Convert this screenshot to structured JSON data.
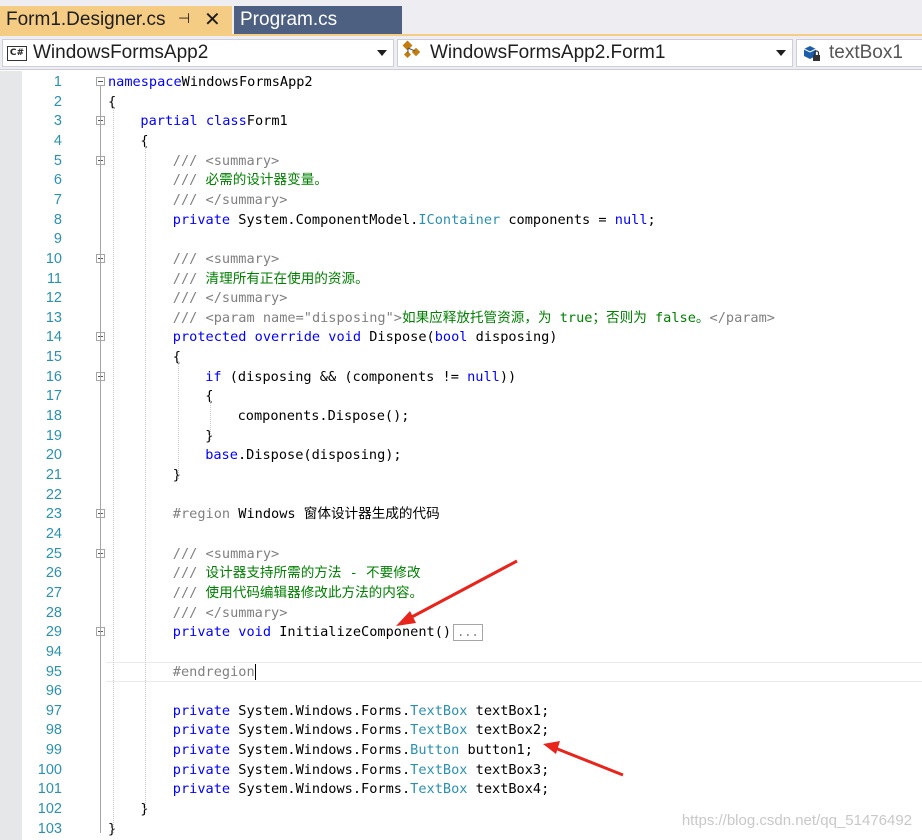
{
  "tabs": [
    {
      "label": "Form1.Designer.cs",
      "active": true
    },
    {
      "label": "Program.cs",
      "active": false
    }
  ],
  "navbar": {
    "project": "WindowsFormsApp2",
    "type": "WindowsFormsApp2.Form1",
    "member": "textBox1"
  },
  "lines": [
    {
      "n": "1",
      "fold": "minus",
      "tokens": [
        [
          "kw",
          "namespace"
        ],
        [
          "",
          "WindowsFormsApp2"
        ]
      ]
    },
    {
      "n": "2",
      "tokens": [
        [
          "",
          "{"
        ]
      ]
    },
    {
      "n": "3",
      "fold": "minus",
      "indent": 1,
      "tokens": [
        [
          "kw",
          "partial class"
        ],
        [
          "",
          "Form1"
        ]
      ]
    },
    {
      "n": "4",
      "indent": 1,
      "tokens": [
        [
          "",
          "{"
        ]
      ]
    },
    {
      "n": "5",
      "fold": "minus",
      "indent": 2,
      "tokens": [
        [
          "cmg",
          "///"
        ],
        [
          "cmg",
          " <summary>"
        ]
      ]
    },
    {
      "n": "6",
      "indent": 2,
      "tokens": [
        [
          "cmg",
          "///"
        ],
        [
          "cm",
          " 必需的设计器变量。"
        ]
      ]
    },
    {
      "n": "7",
      "indent": 2,
      "tokens": [
        [
          "cmg",
          "///"
        ],
        [
          "cmg",
          " </summary>"
        ]
      ]
    },
    {
      "n": "8",
      "indent": 2,
      "tokens": [
        [
          "kw",
          "private"
        ],
        [
          "",
          " System.ComponentModel."
        ],
        [
          "ty",
          "IContainer"
        ],
        [
          "",
          " components = "
        ],
        [
          "kw",
          "null"
        ],
        [
          "",
          ";"
        ]
      ]
    },
    {
      "n": "9",
      "tokens": []
    },
    {
      "n": "10",
      "fold": "minus",
      "indent": 2,
      "tokens": [
        [
          "cmg",
          "///"
        ],
        [
          "cmg",
          " <summary>"
        ]
      ]
    },
    {
      "n": "11",
      "indent": 2,
      "tokens": [
        [
          "cmg",
          "///"
        ],
        [
          "cm",
          " 清理所有正在使用的资源。"
        ]
      ]
    },
    {
      "n": "12",
      "indent": 2,
      "tokens": [
        [
          "cmg",
          "///"
        ],
        [
          "cmg",
          " </summary>"
        ]
      ]
    },
    {
      "n": "13",
      "indent": 2,
      "tokens": [
        [
          "cmg",
          "///"
        ],
        [
          "cmg",
          " <param name=\""
        ],
        [
          "cmg",
          "disposing"
        ],
        [
          "cmg",
          "\">"
        ],
        [
          "cm",
          "如果应释放托管资源，为 true；否则为 false。"
        ],
        [
          "cmg",
          "</param>"
        ]
      ]
    },
    {
      "n": "14",
      "fold": "minus",
      "indent": 2,
      "tokens": [
        [
          "kw",
          "protected override void"
        ],
        [
          "",
          " Dispose("
        ],
        [
          "kw",
          "bool"
        ],
        [
          "",
          " disposing)"
        ]
      ]
    },
    {
      "n": "15",
      "indent": 2,
      "tokens": [
        [
          "",
          "{"
        ]
      ]
    },
    {
      "n": "16",
      "fold": "minus",
      "indent": 3,
      "tokens": [
        [
          "kw",
          "if"
        ],
        [
          "",
          " (disposing && (components != "
        ],
        [
          "kw",
          "null"
        ],
        [
          "",
          "))"
        ]
      ]
    },
    {
      "n": "17",
      "indent": 3,
      "tokens": [
        [
          "",
          "{"
        ]
      ]
    },
    {
      "n": "18",
      "indent": 4,
      "tokens": [
        [
          "",
          "components.Dispose();"
        ]
      ]
    },
    {
      "n": "19",
      "indent": 3,
      "tokens": [
        [
          "",
          "}"
        ]
      ]
    },
    {
      "n": "20",
      "indent": 3,
      "tokens": [
        [
          "kw",
          "base"
        ],
        [
          "",
          ".Dispose(disposing);"
        ]
      ]
    },
    {
      "n": "21",
      "indent": 2,
      "tokens": [
        [
          "",
          "}"
        ]
      ]
    },
    {
      "n": "22",
      "tokens": []
    },
    {
      "n": "23",
      "fold": "minus",
      "indent": 2,
      "tokens": [
        [
          "pp",
          "#region"
        ],
        [
          "",
          " Windows 窗体设计器生成的代码"
        ]
      ]
    },
    {
      "n": "24",
      "tokens": []
    },
    {
      "n": "25",
      "fold": "minus",
      "indent": 2,
      "tokens": [
        [
          "cmg",
          "///"
        ],
        [
          "cmg",
          " <summary>"
        ]
      ]
    },
    {
      "n": "26",
      "indent": 2,
      "tokens": [
        [
          "cmg",
          "///"
        ],
        [
          "cm",
          " 设计器支持所需的方法 - 不要修改"
        ]
      ]
    },
    {
      "n": "27",
      "indent": 2,
      "tokens": [
        [
          "cmg",
          "///"
        ],
        [
          "cm",
          " 使用代码编辑器修改此方法的内容。"
        ]
      ]
    },
    {
      "n": "28",
      "indent": 2,
      "tokens": [
        [
          "cmg",
          "///"
        ],
        [
          "cmg",
          " </summary>"
        ]
      ]
    },
    {
      "n": "29",
      "fold": "plus",
      "indent": 2,
      "collapsed": "...",
      "tokens": [
        [
          "kw",
          "private void"
        ],
        [
          "",
          " InitializeComponent()"
        ]
      ]
    },
    {
      "n": "94",
      "tokens": []
    },
    {
      "n": "95",
      "indent": 2,
      "caret": true,
      "tokens": [
        [
          "pp",
          "#endregion"
        ]
      ]
    },
    {
      "n": "96",
      "tokens": []
    },
    {
      "n": "97",
      "indent": 2,
      "tokens": [
        [
          "kw",
          "private"
        ],
        [
          "",
          " System.Windows.Forms."
        ],
        [
          "ty",
          "TextBox"
        ],
        [
          "",
          " textBox1;"
        ]
      ]
    },
    {
      "n": "98",
      "indent": 2,
      "tokens": [
        [
          "kw",
          "private"
        ],
        [
          "",
          " System.Windows.Forms."
        ],
        [
          "ty",
          "TextBox"
        ],
        [
          "",
          " textBox2;"
        ]
      ]
    },
    {
      "n": "99",
      "indent": 2,
      "tokens": [
        [
          "kw",
          "private"
        ],
        [
          "",
          " System.Windows.Forms."
        ],
        [
          "ty",
          "Button"
        ],
        [
          "",
          " button1;"
        ]
      ]
    },
    {
      "n": "100",
      "indent": 2,
      "tokens": [
        [
          "kw",
          "private"
        ],
        [
          "",
          " System.Windows.Forms."
        ],
        [
          "ty",
          "TextBox"
        ],
        [
          "",
          " textBox3;"
        ]
      ]
    },
    {
      "n": "101",
      "indent": 2,
      "tokens": [
        [
          "kw",
          "private"
        ],
        [
          "",
          " System.Windows.Forms."
        ],
        [
          "ty",
          "TextBox"
        ],
        [
          "",
          " textBox4;"
        ]
      ]
    },
    {
      "n": "102",
      "indent": 1,
      "tokens": [
        [
          "",
          "}"
        ]
      ]
    },
    {
      "n": "103",
      "tokens": [
        [
          "",
          "}"
        ]
      ]
    }
  ],
  "watermark": "https://blog.csdn.net/qq_51476492",
  "colors": {
    "keyword": "#0000ff",
    "type": "#2b91af",
    "comment": "#008000",
    "line_number": "#2b91af",
    "active_tab": "#f5cc84",
    "inactive_tab": "#4d6082",
    "annotation_arrow": "#e8251c"
  },
  "icons": {
    "project_combo": "csharp-file-icon",
    "type_combo": "class-icon",
    "member_combo": "field-icon"
  }
}
